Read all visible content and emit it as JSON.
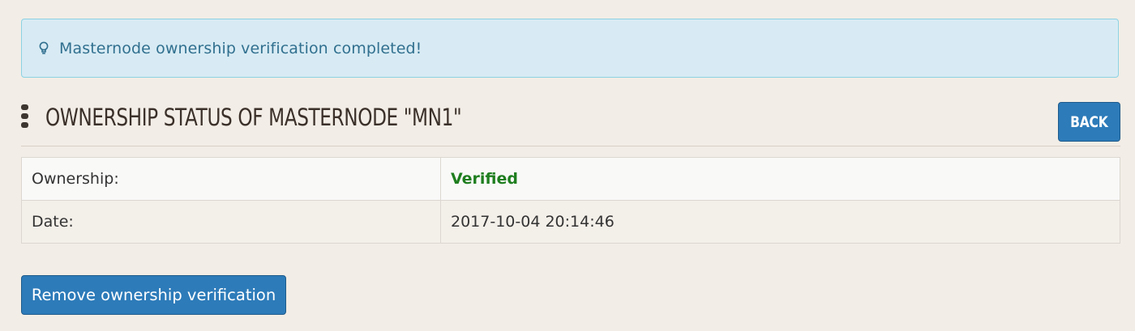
{
  "alert": {
    "icon": "lightbulb-icon",
    "message": "Masternode ownership verification completed!",
    "color": "#31708f",
    "background": "#d8ebf4"
  },
  "header": {
    "title": "OWNERSHIP STATUS OF MASTERNODE \"MN1\"",
    "back_label": "BACK"
  },
  "status_table": {
    "rows": [
      {
        "label": "Ownership:",
        "value": "Verified",
        "value_color": "#1f7e1f"
      },
      {
        "label": "Date:",
        "value": "2017-10-04 20:14:46"
      }
    ]
  },
  "actions": {
    "remove_label": "Remove ownership verification",
    "button_color": "#2d7bb9"
  }
}
